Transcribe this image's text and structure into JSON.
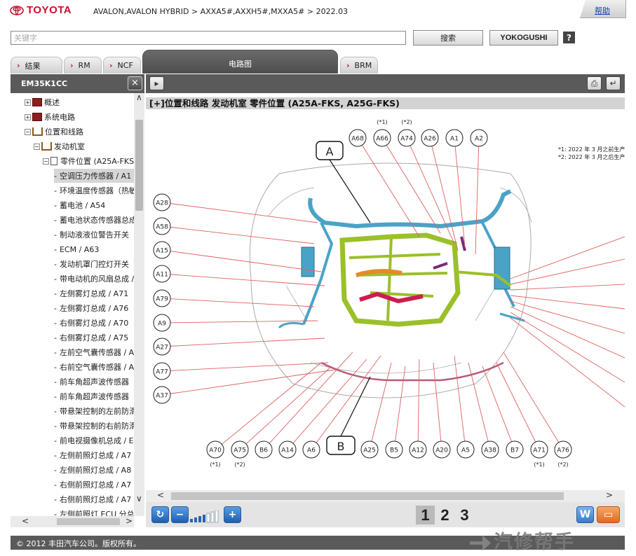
{
  "header": {
    "brand": "TOYOTA",
    "breadcrumb": "AVALON,AVALON HYBRID > AXXA5#,AXXH5#,MXXA5# > 2022.03",
    "help_label": "帮助"
  },
  "search": {
    "placeholder": "关键字",
    "search_label": "搜索",
    "yokogushi_label": "YOKOGUSHI",
    "help_icon": "?"
  },
  "tabs": [
    {
      "label": "结果",
      "active": false
    },
    {
      "label": "RM",
      "active": false
    },
    {
      "label": "NCF",
      "active": false
    },
    {
      "label": "电路图",
      "active": true
    },
    {
      "label": "BRM",
      "active": false
    }
  ],
  "left_panel": {
    "title": "EM35K1CC",
    "close_icon": "×",
    "tree": [
      "概述",
      "系统电路",
      "位置和线路",
      "发动机室",
      "零件位置 (A25A-FKS",
      "空调压力传感器 / A1",
      "环境温度传感器（热敏",
      "蓄电池 / A54",
      "蓄电池状态传感器总成",
      "制动液液位警告开关（",
      "ECM / A63",
      "发动机罩门控灯开关（",
      "带电动机的风扇总成 /",
      "左侧雾灯总成 / A71",
      "左侧雾灯总成 / A76",
      "右侧雾灯总成 / A70",
      "右侧雾灯总成 / A75",
      "左前空气囊传感器 / A",
      "右前空气囊传感器 / A",
      "前车角超声波传感器（",
      "前车角超声波传感器（",
      "带悬架控制的左前防滑",
      "带悬架控制的右前防滑",
      "前电视摄像机总成 / E",
      "左侧前照灯总成 / A7",
      "左侧前照灯总成 / A8",
      "右侧前照灯总成 / A7",
      "右侧前照灯总成 / A7",
      "左侧前照灯 ECU 分总"
    ]
  },
  "content": {
    "title": "[+]位置和线路  发动机室  零件位置 (A25A-FKS, A25G-FKS)",
    "notes": [
      "*1: 2022 年 3 月之前生产",
      "*2: 2022 年 3 月之后生产"
    ],
    "callout_a": "A",
    "callout_b": "B",
    "top_labels": [
      "A68",
      "A66",
      "A74",
      "A26",
      "A1",
      "A2"
    ],
    "top_notes": [
      "(*1)",
      "(*2)"
    ],
    "left_labels": [
      "A28",
      "A58",
      "A15",
      "A11",
      "A79",
      "A9",
      "A27",
      "A77",
      "A37"
    ],
    "bottom_labels": [
      "A70",
      "A75",
      "B6",
      "A14",
      "A6",
      "A25",
      "B5",
      "A12",
      "A20",
      "A5",
      "A38",
      "B7",
      "A71",
      "A76"
    ],
    "bottom_notes": [
      "(*1)",
      "(*2)",
      "(*1)",
      "(*2)"
    ]
  },
  "zoom": {
    "pages": [
      "1",
      "2",
      "3"
    ],
    "refresh_icon": "refresh-icon",
    "zoom_out_icon": "zoom-out-icon",
    "zoom_in_icon": "zoom-in-icon",
    "w_label": "W"
  },
  "footer": {
    "copyright": "© 2012 丰田汽车公司。版权所有。"
  },
  "watermark": "汽修帮手",
  "colors": {
    "accent_red": "#c8102e",
    "panel_gray": "#5a5a5a",
    "harness_blue": "#4aa3c7",
    "harness_green": "#9ac02a"
  }
}
